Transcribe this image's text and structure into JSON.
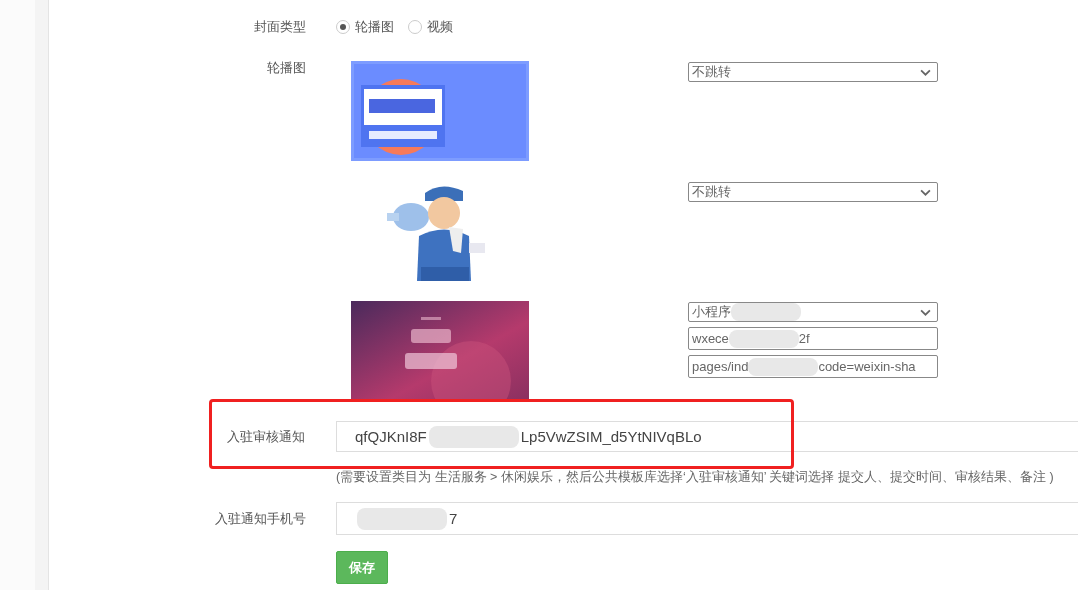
{
  "cover_type": {
    "label": "封面类型",
    "options": [
      {
        "label": "轮播图",
        "selected": true
      },
      {
        "label": "视频",
        "selected": false
      }
    ]
  },
  "carousel": {
    "label": "轮播图",
    "slides": [
      {
        "kind": "picture",
        "jump": {
          "segments": [
            {
              "kind": "text",
              "text": "不跳转"
            }
          ]
        }
      },
      {
        "kind": "picture",
        "jump": {
          "segments": [
            {
              "kind": "text",
              "text": "不跳转"
            }
          ]
        }
      },
      {
        "kind": "picture",
        "jump": {
          "segments": [
            {
              "kind": "text",
              "text": "小程序"
            },
            {
              "kind": "redacted"
            }
          ]
        },
        "appid": {
          "segments": [
            {
              "kind": "text",
              "text": "wxece"
            },
            {
              "kind": "redacted"
            },
            {
              "kind": "text",
              "text": "2f"
            }
          ]
        },
        "path": {
          "segments": [
            {
              "kind": "text",
              "text": "pages/ind"
            },
            {
              "kind": "redacted"
            },
            {
              "kind": "text",
              "text": "code=weixin-sha"
            }
          ]
        }
      }
    ]
  },
  "review_notice": {
    "label": "入驻审核通知",
    "highlighted": true,
    "segments": [
      {
        "kind": "text",
        "text": "qfQJKnI8F"
      },
      {
        "kind": "redacted"
      },
      {
        "kind": "text",
        "text": "Lp5VwZSIM_d5YtNIVqBLo"
      }
    ],
    "help": "(需要设置类目为 生活服务 > 休闲娱乐，然后公共模板库选择‘入驻审核通知’ 关键词选择 提交人、提交时间、审核结果、备注 )"
  },
  "phone": {
    "label": "入驻通知手机号",
    "segments": [
      {
        "kind": "redacted"
      },
      {
        "kind": "text",
        "text": "7"
      }
    ]
  },
  "save_button": "保存"
}
